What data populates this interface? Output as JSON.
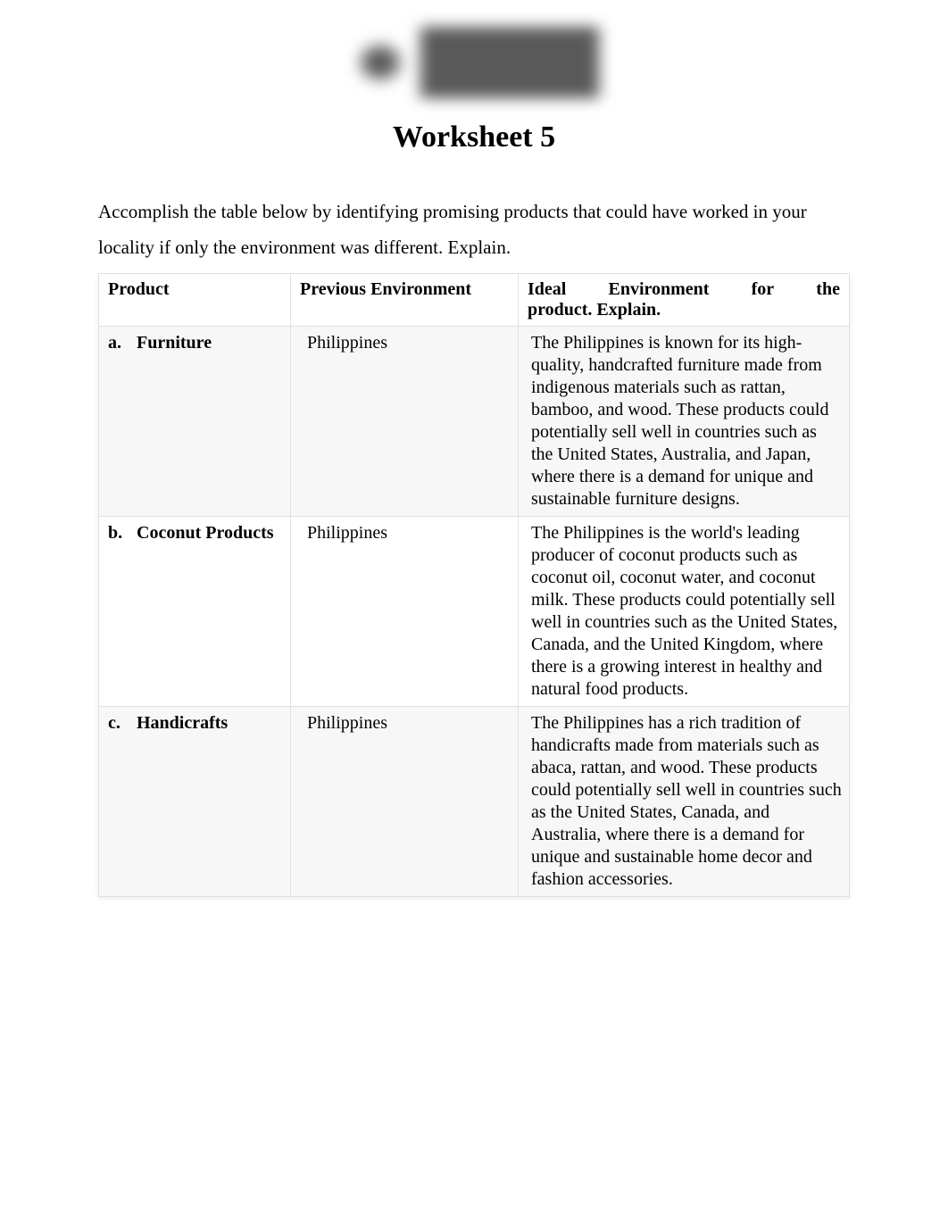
{
  "title": "Worksheet 5",
  "instructions": "Accomplish the table below by identifying promising products that could have worked in your locality if only the environment was different. Explain.",
  "table": {
    "headers": {
      "product": "Product",
      "previous_env": "Previous Environment",
      "ideal_env_line1_word1": "Ideal",
      "ideal_env_line1_word2": "Environment",
      "ideal_env_line1_word3": "for",
      "ideal_env_line1_word4": "the",
      "ideal_env_line2": "product. Explain."
    },
    "rows": [
      {
        "letter": "a.",
        "product": "Furniture",
        "previous_env": "Philippines",
        "ideal_env": "The Philippines is known for its high-quality, handcrafted furniture made from indigenous materials such as rattan, bamboo, and wood. These products could potentially sell well in countries such as the United States, Australia, and Japan, where there is a demand for unique and sustainable furniture designs."
      },
      {
        "letter": "b.",
        "product": "Coconut Products",
        "previous_env": "Philippines",
        "ideal_env": "The Philippines is the world's leading producer of coconut products such as coconut oil, coconut water, and coconut milk. These products could potentially sell well in countries such as the United States, Canada, and the United Kingdom, where there is a growing interest in healthy and natural food products."
      },
      {
        "letter": "c.",
        "product": "Handicrafts",
        "previous_env": "Philippines",
        "ideal_env": "The Philippines has a rich tradition of handicrafts made from materials such as abaca, rattan, and wood. These products could potentially sell well in countries such as the United States, Canada, and Australia, where there is a demand for unique and sustainable home decor and fashion accessories."
      }
    ]
  }
}
